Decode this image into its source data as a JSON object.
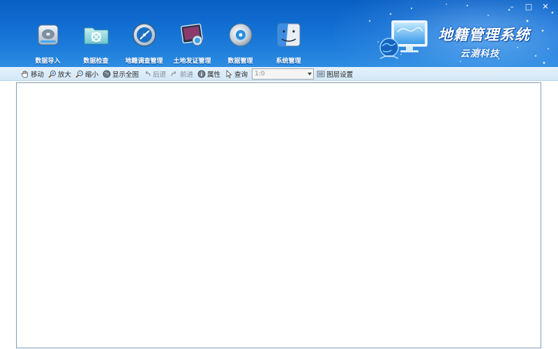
{
  "window_controls": {
    "minimize": "–",
    "maximize": "□",
    "close": "✕"
  },
  "nav": [
    {
      "label": "数据导入",
      "icon": "hard-drive-icon"
    },
    {
      "label": "数据检查",
      "icon": "folder-inspect-icon"
    },
    {
      "label": "地籍调查管理",
      "icon": "survey-dial-icon"
    },
    {
      "label": "土地发证管理",
      "icon": "certificate-photo-icon"
    },
    {
      "label": "数据管理",
      "icon": "disc-icon"
    },
    {
      "label": "系统管理",
      "icon": "finder-face-icon"
    }
  ],
  "brand": {
    "title": "地籍管理系统",
    "subtitle": "云测科技",
    "icon": "globe-monitor-icon"
  },
  "toolbar": {
    "pan": "移动",
    "zoom_in": "放大",
    "zoom_out": "缩小",
    "full_extent": "显示全图",
    "back": "后退",
    "forward": "前进",
    "properties": "属性",
    "query": "查询",
    "scale_value": "1:0",
    "layer_settings": "图层设置"
  },
  "colors": {
    "header_top": "#0a5fc4",
    "header_bottom": "#2d8de2",
    "toolbar_bg": "#dcecf8",
    "canvas_border": "#7f9db9"
  }
}
